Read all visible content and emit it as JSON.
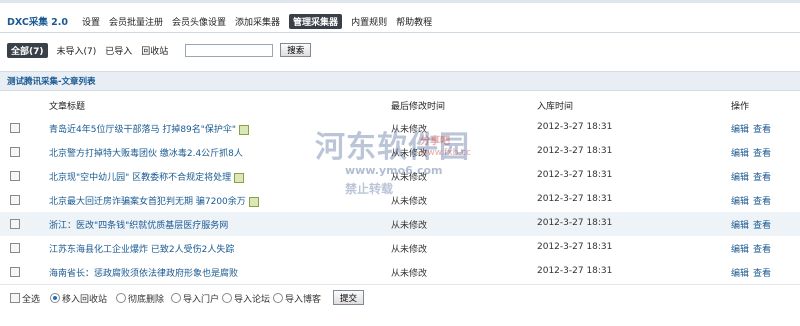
{
  "app": {
    "name": "DXC采集 2.0"
  },
  "nav": [
    "设置",
    "会员批量注册",
    "会员头像设置",
    "添加采集器",
    "管理采集器",
    "内置规则",
    "帮助教程"
  ],
  "filters": [
    "全部(7)",
    "未导入(7)",
    "已导入",
    "回收站"
  ],
  "search": {
    "value": "",
    "button": "搜索"
  },
  "list_title": "测试腾讯采集-文章列表",
  "columns": {
    "title": "文章标题",
    "modified": "最后修改时间",
    "added": "入库时间",
    "actions": "操作"
  },
  "rows": [
    {
      "title": "青岛近4年5位厅级干部落马 打掉89名\"保护伞\"",
      "modified": "从未修改",
      "added": "2012-3-27 18:31",
      "edit": "编辑",
      "view": "查看"
    },
    {
      "title": "北京警方打掉特大贩毒团伙 缴冰毒2.4公斤抓8人",
      "modified": "从未修改",
      "added": "2012-3-27 18:31",
      "edit": "编辑",
      "view": "查看"
    },
    {
      "title": "北京现\"空中幼儿园\" 区教委称不合规定将处理",
      "modified": "从未修改",
      "added": "2012-3-27 18:31",
      "edit": "编辑",
      "view": "查看"
    },
    {
      "title": "北京最大回迁房诈骗案女首犯判无期 骗7200余万",
      "modified": "从未修改",
      "added": "2012-3-27 18:31",
      "edit": "编辑",
      "view": "查看"
    },
    {
      "title": "浙江：医改\"四条钱\"织就优质基层医疗服务网",
      "modified": "从未修改",
      "added": "2012-3-27 18:31",
      "edit": "编辑",
      "view": "查看"
    },
    {
      "title": "江苏东海县化工企业爆炸 已致2人受伤2人失踪",
      "modified": "从未修改",
      "added": "2012-3-27 18:31",
      "edit": "编辑",
      "view": "查看"
    },
    {
      "title": "海南省长：惩政腐败须依法律政府形象也是腐败",
      "modified": "从未修改",
      "added": "2012-3-27 18:31",
      "edit": "编辑",
      "view": "查看"
    }
  ],
  "bulk": {
    "select_all": "全选",
    "options": [
      "移入回收站",
      "彻底删除",
      "导入门户",
      "导入论坛",
      "导入博客"
    ],
    "submit": "提交"
  },
  "watermark": {
    "big": "河东软件园",
    "side": "分享吧",
    "url1": "www.fxb.cc",
    "url2": "www.ymo6.com",
    "cn": "禁止转载"
  }
}
